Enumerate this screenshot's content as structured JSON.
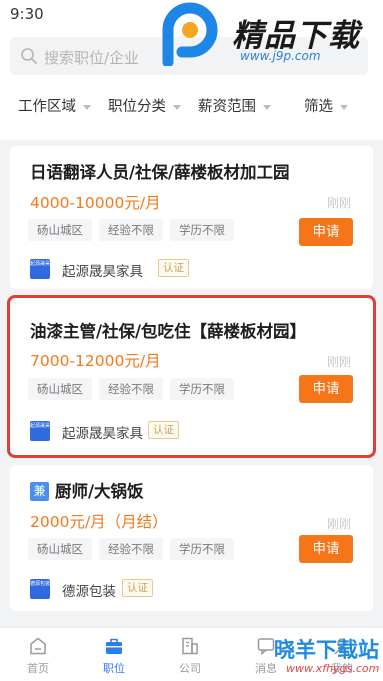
{
  "status_bar": {
    "time": "9:30"
  },
  "watermark": {
    "title": "精品下载",
    "url": "www.j9p.com"
  },
  "search": {
    "placeholder": "搜索职位/企业"
  },
  "filters": [
    {
      "label": "工作区域"
    },
    {
      "label": "职位分类"
    },
    {
      "label": "薪资范围"
    },
    {
      "label": "筛选"
    }
  ],
  "jobs": [
    {
      "title": "日语翻译人员/社保/薛楼板材加工园",
      "salary": "4000-10000元/月",
      "time": "刚刚",
      "tags": [
        "砀山城区",
        "经验不限",
        "学历不限"
      ],
      "apply_label": "申请",
      "company": "起源晟昊家具",
      "cert": "认证",
      "logo_text": "起源晟昊",
      "badge": ""
    },
    {
      "title": "油漆主管/社保/包吃住【薛楼板材园】",
      "salary": "7000-12000元/月",
      "time": "刚刚",
      "tags": [
        "砀山城区",
        "经验不限",
        "学历不限"
      ],
      "apply_label": "申请",
      "company": "起源晟昊家具",
      "cert": "认证",
      "logo_text": "起源晟昊",
      "badge": ""
    },
    {
      "title": "厨师/大锅饭",
      "salary": "2000元/月（月结）",
      "time": "刚刚",
      "tags": [
        "砀山城区",
        "经验不限",
        "学历不限"
      ],
      "apply_label": "申请",
      "company": "德源包装",
      "cert": "认证",
      "logo_text": "德源包装",
      "badge": "兼"
    }
  ],
  "tabbar": [
    {
      "label": "首页"
    },
    {
      "label": "职位"
    },
    {
      "label": "公司"
    },
    {
      "label": "消息"
    },
    {
      "label": "我的"
    }
  ],
  "watermark_bottom": {
    "title": "晓羊下载站",
    "url": "www.xfhygs.com"
  },
  "colors": {
    "accent": "#f77519",
    "salary": "#f07b1a",
    "tab_active": "#2d7cf0",
    "highlight": "#e23d3d"
  }
}
